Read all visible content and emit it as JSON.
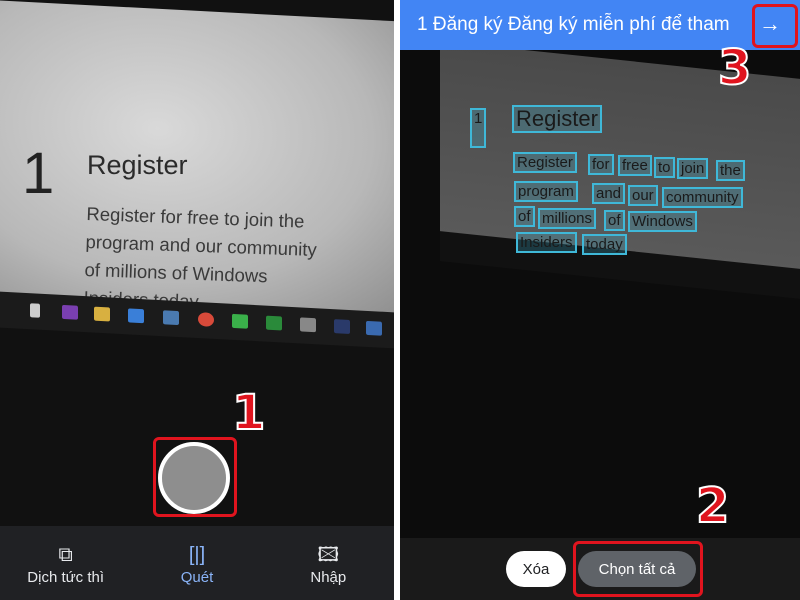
{
  "left": {
    "camera_text": {
      "number": "1",
      "heading": "Register",
      "paragraph": [
        "Register for free to join the",
        "program and our community",
        "of millions of Windows",
        "Insiders today"
      ]
    },
    "nav": [
      {
        "label": "Dịch tức thì",
        "icon": "instant-translate-icon"
      },
      {
        "label": "Quét",
        "icon": "scan-icon",
        "active": true
      },
      {
        "label": "Nhập",
        "icon": "import-image-icon"
      }
    ],
    "annotation": "1"
  },
  "right": {
    "translation_bar": {
      "text": "1 Đăng ký Đăng ký miễn phí để tham",
      "button_icon": "arrow-right-icon"
    },
    "detected_words": [
      "1",
      "Register",
      "Register",
      "for",
      "free",
      "to",
      "join",
      "the",
      "program",
      "and",
      "our",
      "community",
      "of",
      "millions",
      "of",
      "Windows",
      "Insiders",
      "today"
    ],
    "buttons": {
      "clear": "Xóa",
      "select_all": "Chọn tất cả"
    },
    "annotations": [
      "2",
      "3"
    ]
  },
  "colors": {
    "accent": "#4285f4",
    "annotation": "#e0141e",
    "detect_box": "#3fb8d8"
  }
}
